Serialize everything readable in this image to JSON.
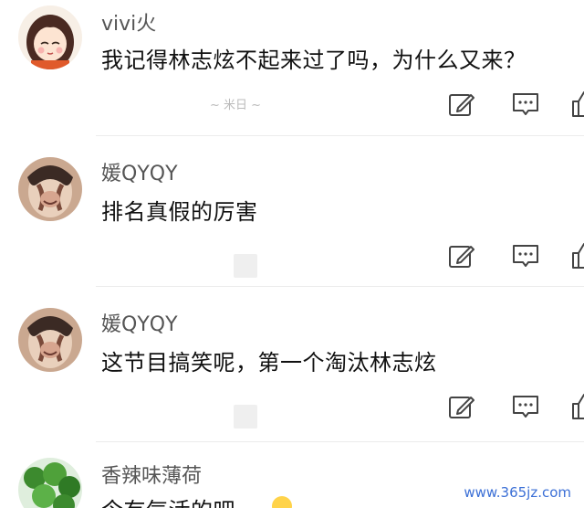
{
  "comments": [
    {
      "username": "vivi火",
      "text": "我记得林志炫不起来过了吗，为什么又来？",
      "fragment": "~ 米日 ~"
    },
    {
      "username": "媛QYQY",
      "text": "排名真假的厉害"
    },
    {
      "username": "媛QYQY",
      "text": "这节目搞笑呢，第一个淘汰林志炫"
    },
    {
      "username": "香辣味薄荷",
      "text": "今有气活的吧"
    }
  ],
  "actions": {
    "edit_icon": "edit-square-icon",
    "reply_icon": "comment-icon",
    "like_icon": "thumbs-up-icon"
  },
  "watermark": "www.365jz.com",
  "colors": {
    "username": "#555555",
    "text": "#111111",
    "watermark": "#3b6fd6"
  }
}
